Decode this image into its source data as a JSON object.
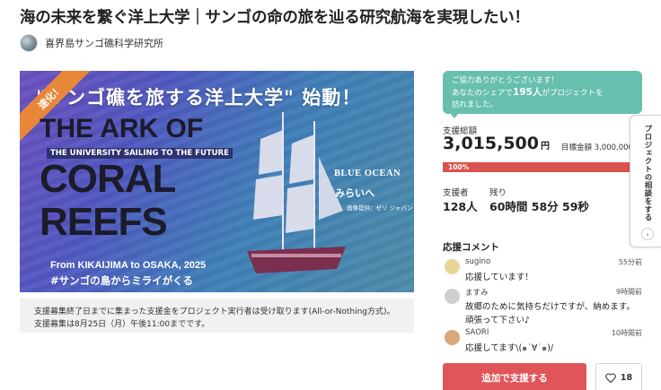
{
  "project": {
    "title": "海の未来を繋ぐ洋上大学｜サンゴの命の旅を辿る研究航海を実現したい！",
    "owner_name": "喜界島サンゴ礁科学研究所"
  },
  "hero": {
    "ribbon_label": "速化！",
    "headline": "\"サンゴ礁を旅する洋上大学\" 始動！",
    "title_line1": "THE ARK OF",
    "subtitle_band": "THE UNIVERSITY SAILING TO THE FUTURE",
    "title_line2": "CORAL",
    "title_line3": "REEFS",
    "blue_ocean": "BLUE OCEAN",
    "mirai": "みらいへ",
    "photo_credit": "画像提供：ゼリ ジャパン",
    "route": "From KIKAIJIMA to OSAKA, 2025",
    "hashtag": "#サンゴの島からミライがくる"
  },
  "note": "支援募集終了日までに集まった支援金をプロジェクト実行者は受け取ります(All-or-Nothing方式)。支援募集は8月25日（月）午後11:00までです。",
  "thanks_bubble": {
    "line1": "ご協力ありがとうございます！",
    "line2_prefix": "あなたのシェアで",
    "line2_count": "195人",
    "line2_suffix": "がプロジェクトを",
    "line3": "訪れました。"
  },
  "stats": {
    "total_label": "支援総額",
    "total_amount": "3,015,500",
    "total_unit": "円",
    "goal_text": "目標金額 3,000,000円",
    "progress_text": "100%",
    "progress_percent": 100,
    "supporters_label": "支援者",
    "supporters_value": "128人",
    "remaining_label": "残り",
    "remaining_value": "60時間 58分 59秒"
  },
  "comments": {
    "title": "応援コメント",
    "items": [
      {
        "name": "sugino",
        "time": "55分前",
        "body": "応援しています！",
        "avatar_color": "#e8d59a"
      },
      {
        "name": "ますみ",
        "time": "9時間前",
        "body": "故郷のために気持ちだけですが、納めます。 頑張って下さい♪",
        "avatar_color": "#cfcfcf"
      },
      {
        "name": "SAORI",
        "time": "10時間前",
        "body": "応援してます\\(๑˙∀˙๑)/",
        "avatar_color": "#d9a77a"
      }
    ]
  },
  "actions": {
    "support_label": "追加で支援する",
    "favorite_count": "18"
  },
  "consult_tab": {
    "label": "プロジェクトの相談をする"
  },
  "colors": {
    "accent_red": "#e05558",
    "bubble_teal": "#67bfae",
    "progress_red": "#d9534f"
  }
}
